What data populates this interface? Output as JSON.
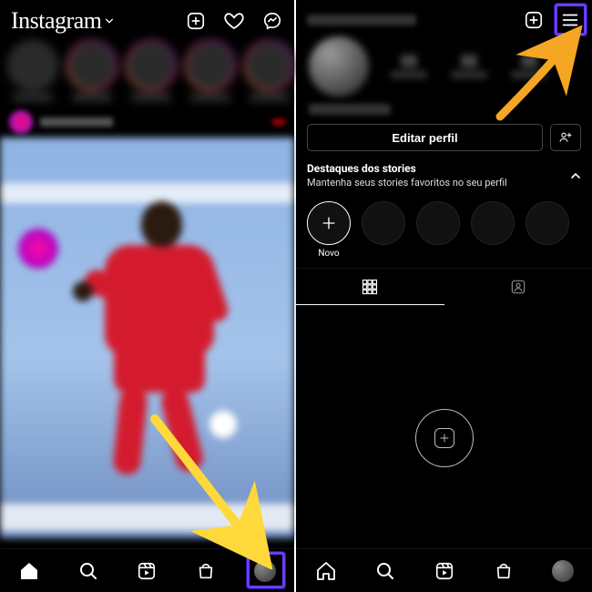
{
  "left": {
    "logo_text": "Instagram"
  },
  "right": {
    "edit_profile_label": "Editar perfil",
    "highlights": {
      "title": "Destaques dos stories",
      "subtitle": "Mantenha seus stories favoritos no seu perfil",
      "new_label": "Novo"
    }
  },
  "colors": {
    "highlight_box": "#6b3df5",
    "arrow_left": "#ffd93b",
    "arrow_right": "#f5a623"
  }
}
